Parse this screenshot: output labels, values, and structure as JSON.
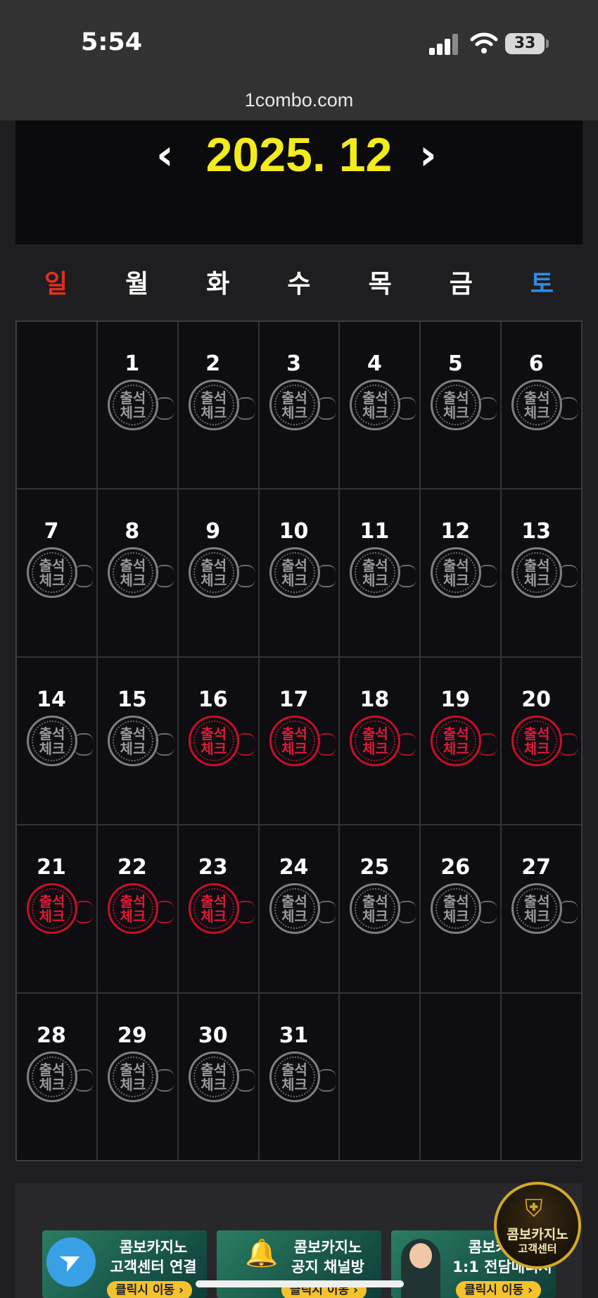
{
  "status_bar": {
    "time": "5:54",
    "battery": "33",
    "icons": [
      "signal-icon",
      "wifi-icon",
      "battery-icon"
    ]
  },
  "browser": {
    "url": "1combo.com"
  },
  "calendar": {
    "month_title": "2025. 12",
    "prev_icon": "‹",
    "next_icon": "›",
    "weekdays": [
      {
        "label": "일",
        "color": "#e0301e"
      },
      {
        "label": "월",
        "color": "#ffffff"
      },
      {
        "label": "화",
        "color": "#ffffff"
      },
      {
        "label": "수",
        "color": "#ffffff"
      },
      {
        "label": "목",
        "color": "#ffffff"
      },
      {
        "label": "금",
        "color": "#ffffff"
      },
      {
        "label": "토",
        "color": "#2f8be6"
      }
    ],
    "stamp_text": [
      "출석",
      "체크"
    ],
    "days": [
      {
        "day": ""
      },
      {
        "day": "1",
        "checked": false
      },
      {
        "day": "2",
        "checked": false
      },
      {
        "day": "3",
        "checked": false
      },
      {
        "day": "4",
        "checked": false
      },
      {
        "day": "5",
        "checked": false
      },
      {
        "day": "6",
        "checked": false
      },
      {
        "day": "7",
        "checked": false
      },
      {
        "day": "8",
        "checked": false
      },
      {
        "day": "9",
        "checked": false
      },
      {
        "day": "10",
        "checked": false
      },
      {
        "day": "11",
        "checked": false
      },
      {
        "day": "12",
        "checked": false
      },
      {
        "day": "13",
        "checked": false
      },
      {
        "day": "14",
        "checked": false
      },
      {
        "day": "15",
        "checked": false
      },
      {
        "day": "16",
        "checked": true
      },
      {
        "day": "17",
        "checked": true
      },
      {
        "day": "18",
        "checked": true
      },
      {
        "day": "19",
        "checked": true
      },
      {
        "day": "20",
        "checked": true
      },
      {
        "day": "21",
        "checked": true
      },
      {
        "day": "22",
        "checked": true
      },
      {
        "day": "23",
        "checked": true
      },
      {
        "day": "24",
        "checked": false
      },
      {
        "day": "25",
        "checked": false
      },
      {
        "day": "26",
        "checked": false
      },
      {
        "day": "27",
        "checked": false
      },
      {
        "day": "28",
        "checked": false
      },
      {
        "day": "29",
        "checked": false
      },
      {
        "day": "30",
        "checked": false
      },
      {
        "day": "31",
        "checked": false
      },
      {
        "day": ""
      },
      {
        "day": ""
      },
      {
        "day": ""
      }
    ]
  },
  "banners": [
    {
      "line1": "콤보카지노",
      "line2": "고객센터 연결",
      "cta": "클릭시 이동 ›",
      "icon": "telegram-icon"
    },
    {
      "line1": "콤보카지노",
      "line2": "공지 채널방",
      "cta": "클릭시 이동 ›",
      "icon": "bell-icon"
    },
    {
      "line1": "콤보카지노",
      "line2": "1:1 전담매니저",
      "cta": "클릭시 이동 ›",
      "icon": "agent-icon"
    }
  ],
  "cs_badge": {
    "line1": "콤보카지노",
    "line2": "고객센터"
  },
  "colors": {
    "checked_stamp": "#c5102a",
    "unchecked_stamp": "#7e7e7e",
    "month_title": "#f2eb1e"
  }
}
